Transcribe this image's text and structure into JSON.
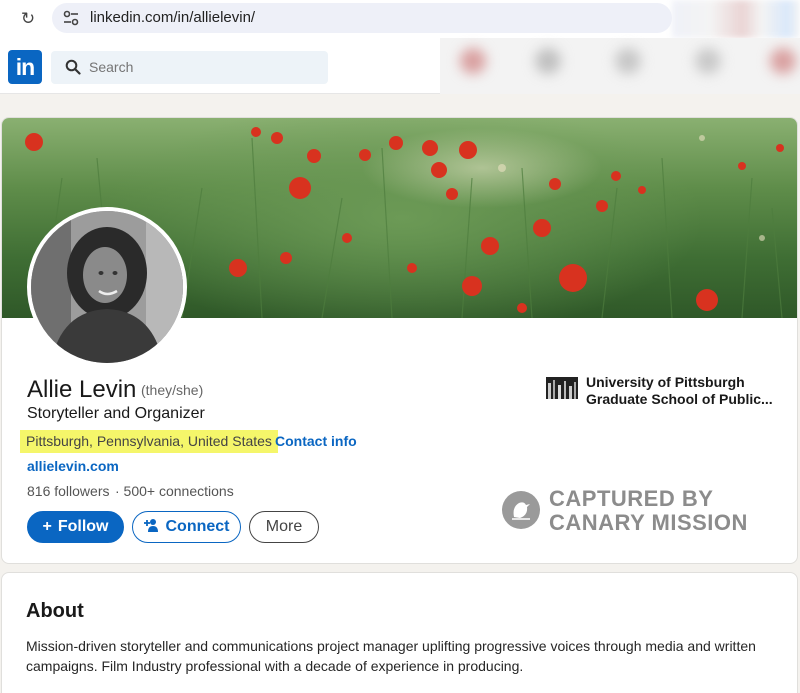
{
  "browser": {
    "url": "linkedin.com/in/allielevin/",
    "reload_icon": "reload-icon",
    "site_icon": "site-settings-icon"
  },
  "nav": {
    "logo_text": "in",
    "search_placeholder": "Search",
    "brand_color": "#0a66c2"
  },
  "profile": {
    "name": "Allie Levin",
    "pronouns": "(they/she)",
    "headline": "Storyteller and Organizer",
    "location": "Pittsburgh, Pennsylvania, United States",
    "separator": "·",
    "contact_info": "Contact info",
    "website": "allielevin.com",
    "followers": "816 followers",
    "connections": "· 500+ connections",
    "highlight_color": "#f5f66a"
  },
  "actions": {
    "follow_icon": "+",
    "follow": "Follow",
    "connect": "Connect",
    "more": "More"
  },
  "education": {
    "line1": "University of Pittsburgh",
    "line2": "Graduate School of Public..."
  },
  "watermark": {
    "line1": "CAPTURED BY",
    "line2": "CANARY MISSION"
  },
  "about": {
    "title": "About",
    "text": "Mission-driven storyteller and communications project manager uplifting progressive voices through media and written campaigns. Film Industry professional with a decade of experience in producing."
  }
}
